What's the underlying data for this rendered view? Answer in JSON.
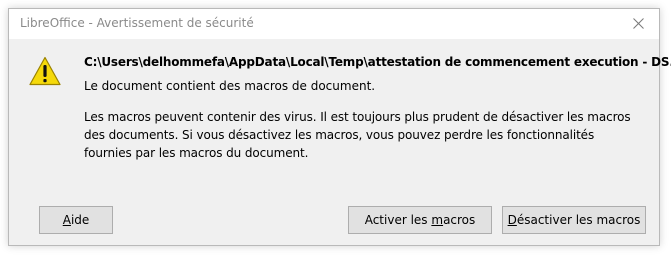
{
  "window": {
    "title": "LibreOffice - Avertissement de sécurité",
    "close_icon": "close-icon"
  },
  "message": {
    "icon": "warning-icon",
    "icon_color": "#f5d90a",
    "file_path": "C:\\Users\\delhommefa\\AppData\\Local\\Temp\\attestation de commencement execution - DS.odt",
    "contains_macros": "Le document contient des macros de document.",
    "warning": "Les macros peuvent contenir des virus. Il est toujours plus prudent de désactiver les macros des documents. Si vous désactivez les macros, vous pouvez perdre les fonctionnalités fournies par les macros du document."
  },
  "buttons": {
    "help": {
      "mnemonic": "A",
      "rest": "ide",
      "label": "Aide"
    },
    "enable": {
      "before": "Activer les ",
      "mnemonic": "m",
      "after": "acros",
      "label": "Activer les macros"
    },
    "disable": {
      "mnemonic": "D",
      "rest": "ésactiver les macros",
      "label": "Désactiver les macros"
    }
  }
}
